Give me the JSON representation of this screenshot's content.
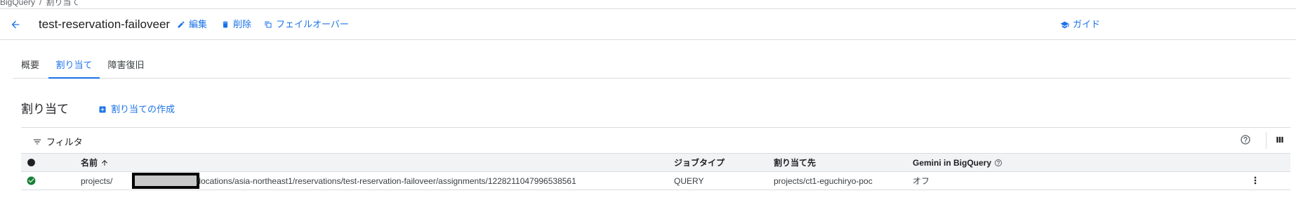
{
  "breadcrumb": {
    "parent": "BigQuery",
    "separator": "/",
    "current": "割り当て"
  },
  "header": {
    "title": "test-reservation-failoveer",
    "actions": {
      "edit": "編集",
      "delete": "削除",
      "failover": "フェイルオーバー",
      "guide": "ガイド"
    }
  },
  "tabs": [
    {
      "label": "概要"
    },
    {
      "label": "割り当て"
    },
    {
      "label": "障害復旧"
    }
  ],
  "active_tab": "割り当て",
  "section": {
    "title": "割り当て",
    "create_label": "割り当ての作成"
  },
  "filter": {
    "label": "フィルタ"
  },
  "table": {
    "columns": {
      "name": "名前",
      "job_type": "ジョブタイプ",
      "assignee": "割り当て先",
      "gemini": "Gemini in BigQuery"
    },
    "rows": [
      {
        "status": "ok",
        "name_prefix": "projects/",
        "name_suffix": "/locations/asia-northeast1/reservations/test-reservation-failoveer/assignments/1228211047996538561",
        "job_type": "QUERY",
        "assignee": "projects/ct1-eguchiryo-poc",
        "gemini": "オフ"
      }
    ]
  },
  "colors": {
    "accent": "#1a73e8",
    "success": "#188038",
    "header_bg": "#f1f3f4"
  }
}
